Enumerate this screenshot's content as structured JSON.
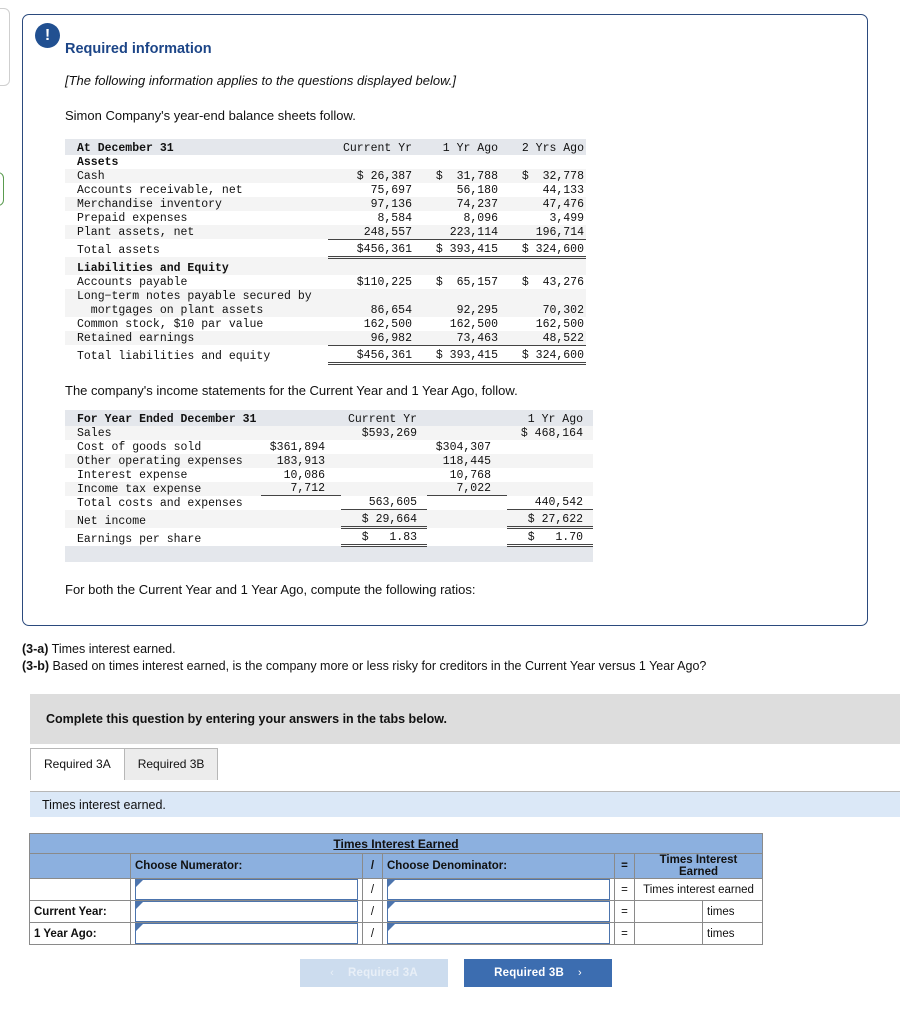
{
  "card": {
    "alert_icon": "exclamation-icon",
    "title": "Required information",
    "note": "[The following information applies to the questions displayed below.]",
    "lead": "Simon Company's year-end balance sheets follow.",
    "mid": "The company's income statements for the Current Year and 1 Year Ago, follow.",
    "tail": "For both the Current Year and 1 Year Ago, compute the following ratios:"
  },
  "balance_sheet": {
    "columns": [
      "At December 31",
      "Current Yr",
      "1 Yr Ago",
      "2 Yrs Ago"
    ],
    "rows": [
      {
        "label": "Assets",
        "bold": true,
        "values": [
          "",
          "",
          ""
        ]
      },
      {
        "label": "Cash",
        "values": [
          "$ 26,387",
          "$  31,788",
          "$  32,778"
        ]
      },
      {
        "label": "Accounts receivable, net",
        "values": [
          "75,697",
          "56,180",
          "44,133"
        ]
      },
      {
        "label": "Merchandise inventory",
        "values": [
          "97,136",
          "74,237",
          "47,476"
        ]
      },
      {
        "label": "Prepaid expenses",
        "values": [
          "8,584",
          "8,096",
          "3,499"
        ]
      },
      {
        "label": "Plant assets, net",
        "values": [
          "248,557",
          "223,114",
          "196,714"
        ],
        "rule": "single"
      },
      {
        "label": "Total assets",
        "values": [
          "$456,361",
          "$ 393,415",
          "$ 324,600"
        ],
        "rule": "double"
      },
      {
        "label": "Liabilities and Equity",
        "bold": true,
        "values": [
          "",
          "",
          ""
        ]
      },
      {
        "label": "Accounts payable",
        "values": [
          "$110,225",
          "$  65,157",
          "$  43,276"
        ]
      },
      {
        "label": "Long−term notes payable secured by",
        "values": [
          "",
          "",
          ""
        ]
      },
      {
        "label": "  mortgages on plant assets",
        "values": [
          "86,654",
          "92,295",
          "70,302"
        ]
      },
      {
        "label": "Common stock, $10 par value",
        "values": [
          "162,500",
          "162,500",
          "162,500"
        ]
      },
      {
        "label": "Retained earnings",
        "values": [
          "96,982",
          "73,463",
          "48,522"
        ],
        "rule": "single"
      },
      {
        "label": "Total liabilities and equity",
        "values": [
          "$456,361",
          "$ 393,415",
          "$ 324,600"
        ],
        "rule": "double"
      }
    ]
  },
  "income_statement": {
    "columns": [
      "For Year Ended December 31",
      "Current Yr",
      "1 Yr Ago"
    ],
    "rows": [
      {
        "label": "Sales",
        "col1": "",
        "col2": "$593,269",
        "col3": "",
        "col4": "$ 468,164"
      },
      {
        "label": "Cost of goods sold",
        "col1": "$361,894",
        "col2": "",
        "col3": "$304,307",
        "col4": ""
      },
      {
        "label": "Other operating expenses",
        "col1": "183,913",
        "col2": "",
        "col3": "118,445",
        "col4": ""
      },
      {
        "label": "Interest expense",
        "col1": "10,086",
        "col2": "",
        "col3": "10,768",
        "col4": ""
      },
      {
        "label": "Income tax expense",
        "col1": "7,712",
        "col2": "",
        "col3": "7,022",
        "col4": "",
        "rule_inner": "single"
      },
      {
        "label": "Total costs and expenses",
        "col1": "",
        "col2": "563,605",
        "col3": "",
        "col4": "440,542",
        "rule_outer": "single"
      },
      {
        "label": "Net income",
        "col1": "",
        "col2": "$ 29,664",
        "col3": "",
        "col4": "$ 27,622",
        "rule_outer": "double"
      },
      {
        "label": "Earnings per share",
        "col1": "",
        "col2": "$   1.83",
        "col3": "",
        "col4": "$   1.70",
        "rule_outer": "double"
      }
    ]
  },
  "subquestions": [
    {
      "tag": "(3-a)",
      "text": " Times interest earned."
    },
    {
      "tag": "(3-b)",
      "text": " Based on times interest earned, is the company more or less risky for creditors in the Current Year versus 1 Year Ago?"
    }
  ],
  "instruction_bar": "Complete this question by entering your answers in the tabs below.",
  "tabs": [
    {
      "label": "Required 3A",
      "active": true
    },
    {
      "label": "Required 3B",
      "active": false
    }
  ],
  "sub_instruction": "Times interest earned.",
  "answer_table": {
    "title": "Times Interest Earned",
    "headers": {
      "numerator": "Choose Numerator:",
      "slash": "/",
      "denominator": "Choose Denominator:",
      "equals": "=",
      "result": "Times Interest Earned"
    },
    "rows": [
      {
        "label": "",
        "numerator": "",
        "slash": "/",
        "denominator": "",
        "equals": "=",
        "result": "Times interest earned",
        "unit": ""
      },
      {
        "label": "Current Year:",
        "numerator": "",
        "slash": "/",
        "denominator": "",
        "equals": "=",
        "result": "",
        "unit": "times"
      },
      {
        "label": "1 Year Ago:",
        "numerator": "",
        "slash": "/",
        "denominator": "",
        "equals": "=",
        "result": "",
        "unit": "times"
      }
    ]
  },
  "nav": {
    "prev_label": "Required 3A",
    "prev_chevron": "‹",
    "next_label": "Required 3B",
    "next_chevron": "›"
  },
  "colors": {
    "accent_blue": "#1c4587",
    "card_border": "#2b4a7d",
    "table_header": "#8cb0df",
    "sub_instruction_bg": "#dbe8f7",
    "instruction_bg": "#dddddd",
    "button_active": "#3c6db0",
    "button_disabled": "#ccdcee"
  }
}
